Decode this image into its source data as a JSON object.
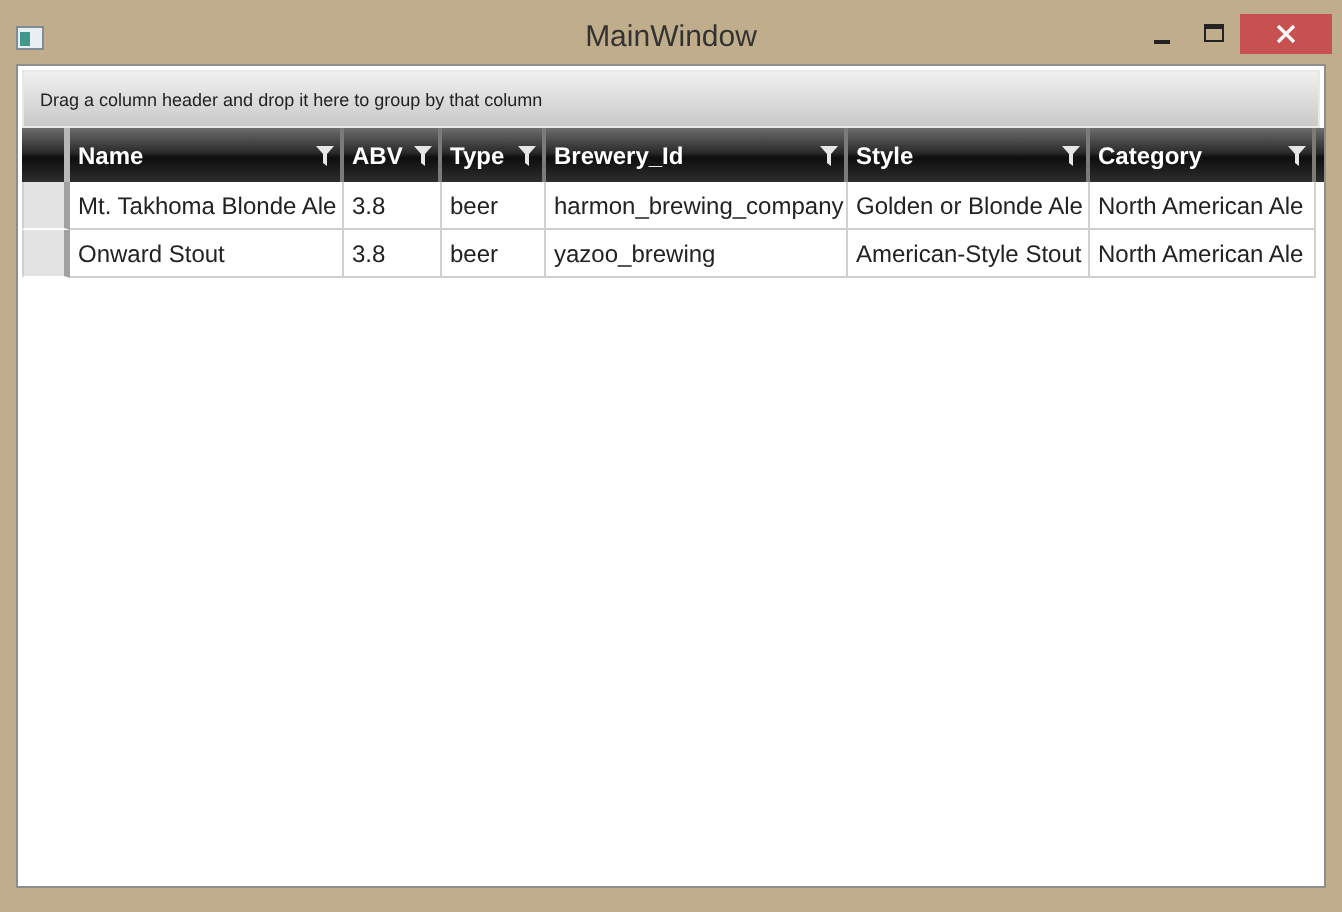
{
  "window": {
    "title": "MainWindow"
  },
  "group_panel": {
    "text": "Drag a column header and drop it here to group by that column"
  },
  "table": {
    "columns": [
      {
        "label": "Name"
      },
      {
        "label": "ABV"
      },
      {
        "label": "Type"
      },
      {
        "label": "Brewery_Id"
      },
      {
        "label": "Style"
      },
      {
        "label": "Category"
      }
    ],
    "rows": [
      [
        "Mt. Takhoma Blonde Ale",
        "3.8",
        "beer",
        "harmon_brewing_company",
        "Golden or Blonde Ale",
        "North American Ale"
      ],
      [
        "Onward Stout",
        "3.8",
        "beer",
        "yazoo_brewing",
        "American-Style Stout",
        "North American Ale"
      ]
    ]
  }
}
